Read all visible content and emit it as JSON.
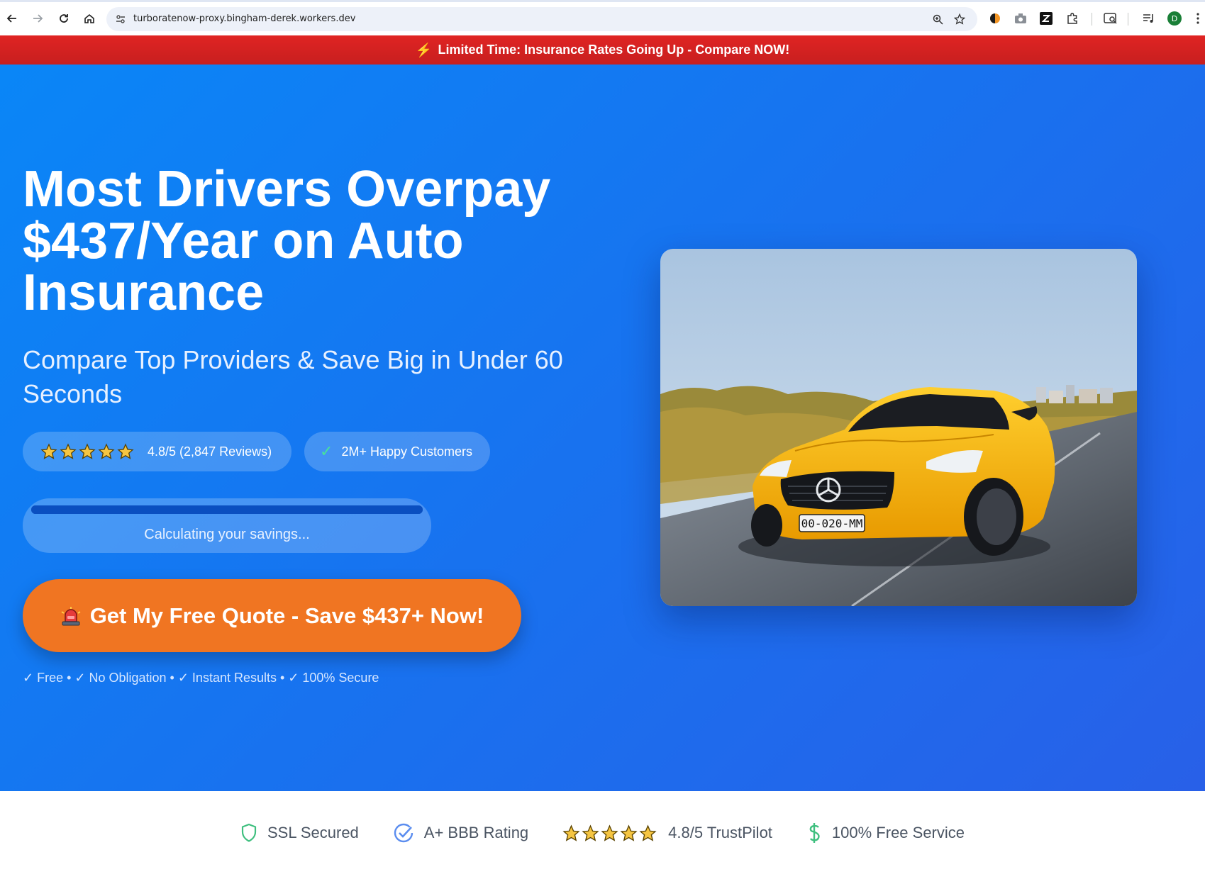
{
  "browser": {
    "url": "turboratenow-proxy.bingham-derek.workers.dev",
    "profile_initial": "D",
    "icons": [
      "back-icon",
      "forward-icon",
      "reload-icon",
      "home-icon",
      "site-info-icon",
      "zoom-icon",
      "bookmark-star-icon",
      "extension-icon",
      "camera-icon",
      "zotero-icon",
      "puzzle-icon",
      "tab-search-icon",
      "media-icon",
      "profile-avatar",
      "menu-kebab-icon"
    ]
  },
  "promo": {
    "text": "Limited Time: Insurance Rates Going Up - Compare NOW!",
    "bolt": "⚡"
  },
  "hero": {
    "headline": "Most Drivers Overpay $437/Year on Auto Insurance",
    "subhead": "Compare Top Providers & Save Big in Under 60 Seconds",
    "rating_text": "4.8/5 (2,847 Reviews)",
    "rating_stars": 5,
    "customers_check": "✓",
    "customers_text": "2M+ Happy Customers",
    "progress_label": "Calculating your savings...",
    "progress_fraction": 1.0,
    "cta_label": "Get My Free Quote - Save $437+ Now!",
    "benefits": "✓ Free • ✓ No Obligation • ✓ Instant Results • ✓ 100% Secure",
    "plate_text": "00-020-MM"
  },
  "trust": {
    "items": [
      {
        "label": "SSL Secured",
        "icon": "shield-icon"
      },
      {
        "label": "A+ BBB Rating",
        "icon": "check-badge-icon"
      },
      {
        "label": "4.8/5 TrustPilot",
        "icon": "stars-icon"
      },
      {
        "label": "100% Free Service",
        "icon": "dollar-icon"
      }
    ]
  },
  "colors": {
    "promo_red": "#d92121",
    "hero_blue": "#1872ef",
    "cta_orange": "#f07522",
    "star_gold": "#f5c542"
  }
}
